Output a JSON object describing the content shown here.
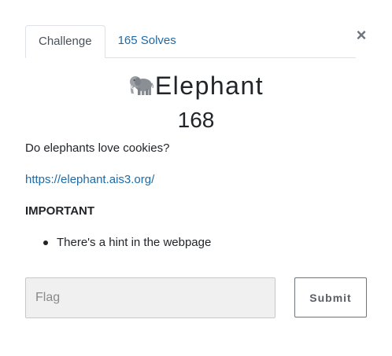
{
  "modal": {
    "close_label": "×"
  },
  "tabs": [
    {
      "label": "Challenge",
      "active": true
    },
    {
      "label": "165 Solves",
      "active": false
    }
  ],
  "challenge": {
    "icon": "elephant-icon",
    "name": "Elephant",
    "points": "168",
    "description": "Do elephants love cookies?",
    "link": "https://elephant.ais3.org/",
    "important_heading": "IMPORTANT",
    "hints": [
      "There's a hint in the webpage"
    ]
  },
  "form": {
    "flag_placeholder": "Flag",
    "flag_value": "",
    "submit_label": "Submit"
  },
  "colors": {
    "link": "#1f6aa5",
    "text": "#212529",
    "input_bg": "#f0f0f0"
  }
}
